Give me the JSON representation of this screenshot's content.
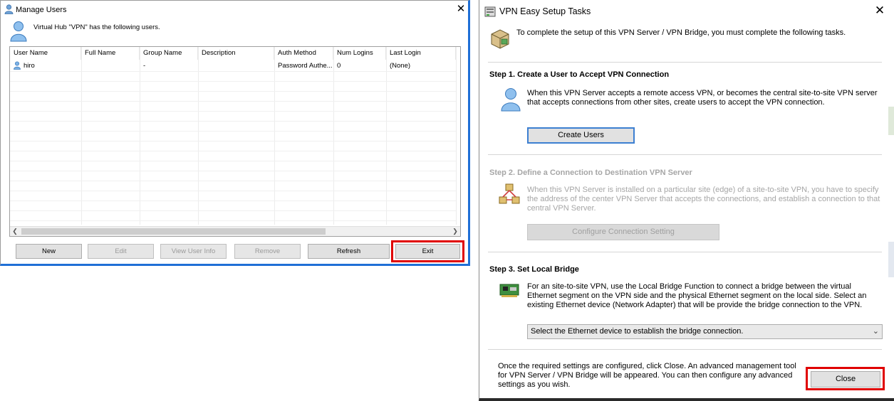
{
  "manage_users": {
    "title": "Manage Users",
    "hub_text": "Virtual Hub \"VPN\" has the following users.",
    "columns": [
      "User Name",
      "Full Name",
      "Group Name",
      "Description",
      "Auth Method",
      "Num Logins",
      "Last Login"
    ],
    "rows": [
      {
        "user_name": "hiro",
        "full_name": "",
        "group_name": "-",
        "description": "",
        "auth_method": "Password Authe...",
        "num_logins": "0",
        "last_login": "(None)"
      }
    ],
    "buttons": {
      "new": "New",
      "edit": "Edit",
      "view_user_info": "View User Info",
      "remove": "Remove",
      "refresh": "Refresh",
      "exit": "Exit"
    }
  },
  "vpn_setup": {
    "title": "VPN Easy Setup Tasks",
    "intro": "To complete the setup of this VPN Server / VPN Bridge, you must complete the following tasks.",
    "step1": {
      "title": "Step 1. Create a User to Accept VPN Connection",
      "desc": "When this VPN Server accepts a remote access VPN, or becomes the central site-to-site VPN server that accepts connections from other sites, create users to accept the VPN connection.",
      "button": "Create Users"
    },
    "step2": {
      "title": "Step 2. Define a Connection to Destination VPN Server",
      "desc": "When this VPN Server is installed on a particular site (edge) of a site-to-site VPN, you have to specify the address of the center VPN Server that accepts the connections, and establish a connection to that central VPN Server.",
      "button": "Configure Connection Setting"
    },
    "step3": {
      "title": "Step 3. Set Local Bridge",
      "desc": "For an site-to-site VPN, use the Local Bridge Function to connect a bridge between the virtual Ethernet segment on the VPN side and the physical Ethernet segment on the local side. Select an existing Ethernet device (Network Adapter) that will be provide the bridge connection to the VPN.",
      "select_value": "Select the Ethernet device to establish the bridge connection."
    },
    "footer": "Once the required settings are configured, click Close. An advanced management tool for VPN Server / VPN Bridge will be appeared. You can then configure any advanced settings as you wish.",
    "close_button": "Close"
  },
  "colors": {
    "highlight": "#e00000",
    "accent_blue": "#1f6fd6"
  }
}
